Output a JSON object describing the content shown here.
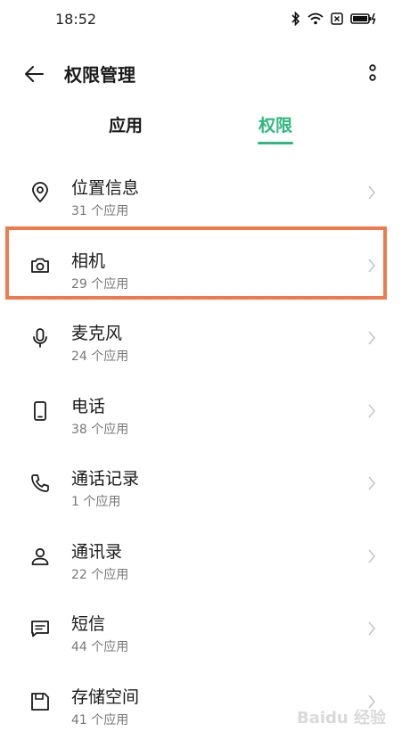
{
  "status_bar": {
    "time": "18:52",
    "icons": [
      "bluetooth-icon",
      "wifi-icon",
      "sim-x-icon",
      "battery-charging-icon"
    ]
  },
  "header": {
    "title": "权限管理",
    "back_icon": "back-arrow-icon",
    "more_icon": "more-vertical-icon"
  },
  "tabs": [
    {
      "label": "应用",
      "active": false
    },
    {
      "label": "权限",
      "active": true
    }
  ],
  "colors": {
    "accent": "#2eb87e",
    "highlight": "#ef7a4c"
  },
  "permissions": [
    {
      "label": "位置信息",
      "count": "31 个应用",
      "icon": "location-pin-icon"
    },
    {
      "label": "相机",
      "count": "29 个应用",
      "icon": "camera-icon"
    },
    {
      "label": "麦克风",
      "count": "24 个应用",
      "icon": "microphone-icon"
    },
    {
      "label": "电话",
      "count": "38 个应用",
      "icon": "phone-device-icon"
    },
    {
      "label": "通话记录",
      "count": "1 个应用",
      "icon": "call-log-icon"
    },
    {
      "label": "通讯录",
      "count": "22 个应用",
      "icon": "contacts-icon"
    },
    {
      "label": "短信",
      "count": "44 个应用",
      "icon": "sms-icon"
    },
    {
      "label": "存储空间",
      "count": "41 个应用",
      "icon": "storage-icon"
    }
  ],
  "watermark": "Baidu 经验"
}
